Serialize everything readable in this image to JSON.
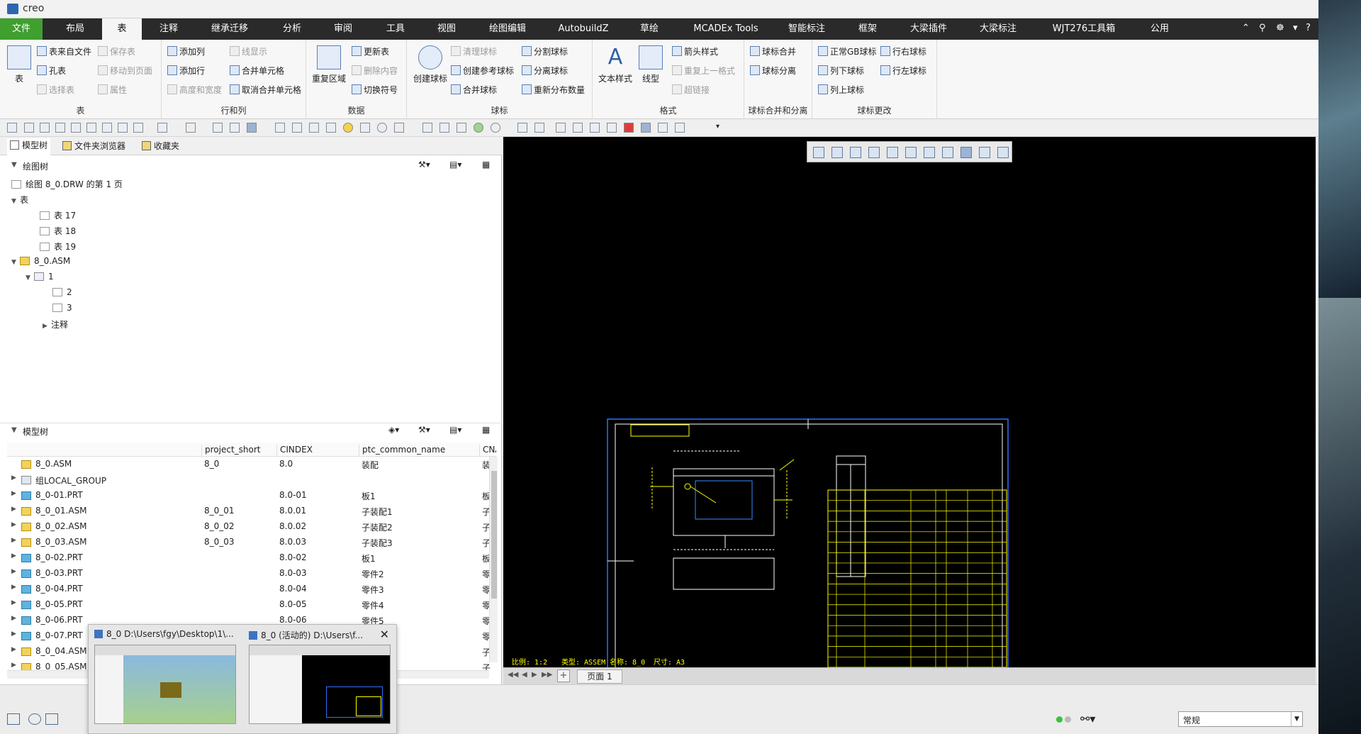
{
  "titlebar": {
    "app_name": "creo"
  },
  "menubar": {
    "tabs": [
      "文件",
      "布局",
      "表",
      "注释",
      "继承迁移",
      "分析",
      "审阅",
      "工具",
      "视图",
      "绘图编辑",
      "AutobuildZ",
      "草绘",
      "MCADEx Tools",
      "智能标注",
      "框架",
      "大梁插件",
      "大梁标注",
      "WJT276工具箱",
      "公用"
    ],
    "active": "表"
  },
  "ribbon": {
    "table_group": {
      "label": "表",
      "big": "表",
      "items": [
        "表来自文件",
        "孔表",
        "选择表",
        "保存表",
        "移动到页面",
        "属性"
      ]
    },
    "rowcol_group": {
      "label": "行和列",
      "items": [
        "添加列",
        "添加行",
        "高度和宽度",
        "线显示",
        "合并单元格",
        "取消合并单元格"
      ]
    },
    "data_group": {
      "label": "数据",
      "big": "重复区域",
      "items": [
        "更新表",
        "删除内容",
        "切换符号"
      ]
    },
    "balloon_group": {
      "label": "球标",
      "big": "创建球标",
      "items": [
        "清理球标",
        "创建参考球标",
        "合并球标",
        "分割球标",
        "分离球标",
        "重新分布数量"
      ]
    },
    "format_group": {
      "label": "格式",
      "bigs": [
        "文本样式",
        "线型"
      ],
      "items": [
        "箭头样式",
        "重复上一格式",
        "超链接"
      ]
    },
    "merge_group": {
      "label": "球标合并和分离",
      "items": [
        "球标合并",
        "球标分离"
      ]
    },
    "modify_group": {
      "label": "球标更改",
      "items": [
        "正常GB球标",
        "列下球标",
        "列上球标",
        "行右球标",
        "行左球标"
      ]
    }
  },
  "left_panel": {
    "tabs": [
      "模型树",
      "文件夹浏览器",
      "收藏夹"
    ],
    "drawing_tree": {
      "title": "绘图树",
      "root": "绘图 8_0.DRW 的第 1 页",
      "tables_node": "表",
      "tables": [
        "表 17",
        "表 18",
        "表 19"
      ],
      "asm": "8_0.ASM",
      "views": [
        "1",
        "2",
        "3"
      ],
      "notes": "注释"
    },
    "model_tree": {
      "title": "模型树",
      "columns": [
        "project_short",
        "CINDEX",
        "ptc_common_name",
        "CNA"
      ],
      "rows": [
        {
          "name": "8_0.ASM",
          "project": "8_0",
          "cindex": "8.0",
          "common": "装配",
          "cna": "装"
        },
        {
          "name": "组LOCAL_GROUP",
          "project": "",
          "cindex": "",
          "common": "",
          "cna": ""
        },
        {
          "name": "8_0-01.PRT",
          "project": "",
          "cindex": "8.0-01",
          "common": "板1",
          "cna": "板"
        },
        {
          "name": "8_0_01.ASM",
          "project": "8_0_01",
          "cindex": "8.0.01",
          "common": "子装配1",
          "cna": "子"
        },
        {
          "name": "8_0_02.ASM",
          "project": "8_0_02",
          "cindex": "8.0.02",
          "common": "子装配2",
          "cna": "子"
        },
        {
          "name": "8_0_03.ASM",
          "project": "8_0_03",
          "cindex": "8.0.03",
          "common": "子装配3",
          "cna": "子"
        },
        {
          "name": "8_0-02.PRT",
          "project": "",
          "cindex": "8.0-02",
          "common": "板1",
          "cna": "板"
        },
        {
          "name": "8_0-03.PRT",
          "project": "",
          "cindex": "8.0-03",
          "common": "零件2",
          "cna": "零"
        },
        {
          "name": "8_0-04.PRT",
          "project": "",
          "cindex": "8.0-04",
          "common": "零件3",
          "cna": "零"
        },
        {
          "name": "8_0-05.PRT",
          "project": "",
          "cindex": "8.0-05",
          "common": "零件4",
          "cna": "零"
        },
        {
          "name": "8_0-06.PRT",
          "project": "",
          "cindex": "8.0-06",
          "common": "零件5",
          "cna": "零"
        },
        {
          "name": "8_0-07.PRT",
          "project": "",
          "cindex": "",
          "common": "",
          "cna": "零"
        },
        {
          "name": "8_0_04.ASM",
          "project": "",
          "cindex": "",
          "common": "",
          "cna": "子"
        },
        {
          "name": "8_0_05.ASM",
          "project": "",
          "cindex": "",
          "common": "",
          "cna": "子"
        }
      ]
    }
  },
  "drawing": {
    "scale_text": "比例: 1:2",
    "type_text": "类型: ASSEM",
    "name_text": "名称: 8_0",
    "size_text": "尺寸: A3",
    "frame_color": "#2f6fff",
    "line_color": "#ffff00"
  },
  "pagebar": {
    "page_tab": "页面 1",
    "add": "+"
  },
  "taskbar_popup": {
    "window1": "8_0 D:\\Users\\fgy\\Desktop\\1\\...",
    "window2": "8_0 (活动的) D:\\Users\\f..."
  },
  "statusbar": {
    "filter_value": "常规"
  }
}
